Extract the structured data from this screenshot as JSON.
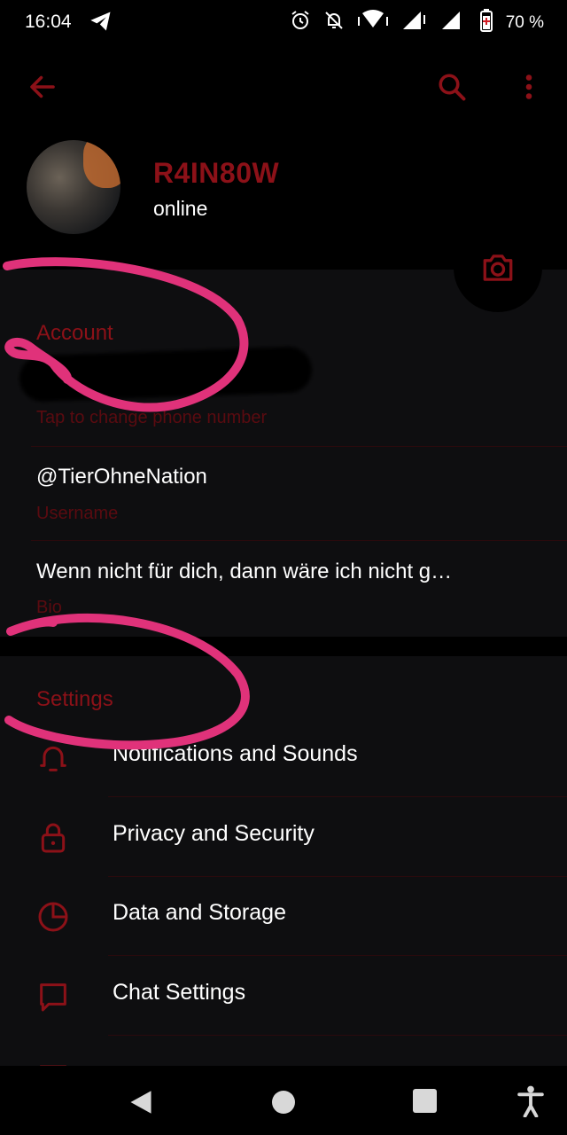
{
  "status_bar": {
    "time": "16:04",
    "battery": "70 %",
    "icons": [
      "telegram-icon",
      "alarm-icon",
      "notifications-off-icon",
      "wifi-icon",
      "signal-icon",
      "battery-icon"
    ]
  },
  "profile": {
    "name": "R4IN80W",
    "status": "online"
  },
  "account": {
    "title": "Account",
    "phone_hint": "Tap to change phone number",
    "username": "@TierOhneNation",
    "username_label": "Username",
    "bio": "Wenn nicht für dich, dann wäre ich nicht g…",
    "bio_label": "Bio"
  },
  "settings": {
    "title": "Settings",
    "items": [
      {
        "label": "Notifications and Sounds",
        "icon": "bell-icon"
      },
      {
        "label": "Privacy and Security",
        "icon": "lock-icon"
      },
      {
        "label": "Data and Storage",
        "icon": "pie-chart-icon"
      },
      {
        "label": "Chat Settings",
        "icon": "chat-bubble-icon"
      }
    ]
  },
  "colors": {
    "accent": "#8c1118",
    "accent_dim": "#5a0b10",
    "background": "#0e0e10",
    "header": "#000000",
    "scribble": "#e0327a"
  }
}
